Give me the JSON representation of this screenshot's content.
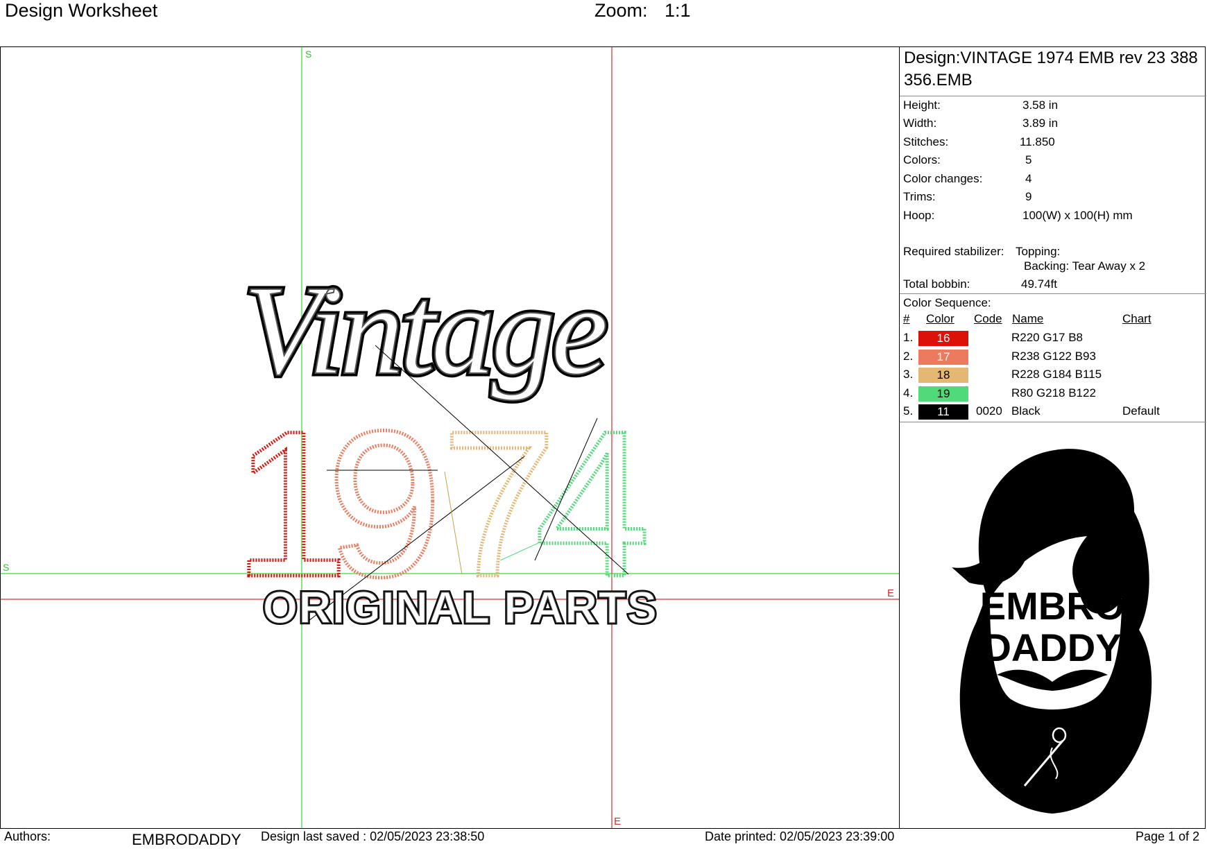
{
  "header": {
    "title": "Design Worksheet",
    "zoom_label": "Zoom:",
    "zoom_value": "1:1"
  },
  "canvas": {
    "guide_labels": {
      "s_top": "S",
      "s_left": "S",
      "e_right": "E",
      "e_bottom": "E"
    },
    "design_text": {
      "script": "Vintage",
      "year_digits": [
        "1",
        "9",
        "7",
        "4"
      ],
      "subtitle": "ORIGINAL PARTS"
    },
    "colors": {
      "green_guide": "#5de05d",
      "red_guide": "#e05555"
    }
  },
  "panel": {
    "design_name": "Design:VINTAGE 1974 EMB rev 23 388 356.EMB",
    "info": [
      {
        "label": "Height:",
        "value": "3.58 in"
      },
      {
        "label": "Width:",
        "value": "3.89 in"
      },
      {
        "label": "Stitches:",
        "value": "11.850"
      },
      {
        "label": "Colors:",
        "value": "5"
      },
      {
        "label": "Color changes:",
        "value": "4"
      },
      {
        "label": "Trims:",
        "value": "9"
      },
      {
        "label": "Hoop:",
        "value": "100(W) x 100(H) mm"
      }
    ],
    "stabilizer": {
      "label": "Required stabilizer:",
      "topping": "Topping:",
      "backing": "Backing: Tear Away x 2"
    },
    "bobbin": {
      "label": "Total bobbin:",
      "value": "49.74ft"
    },
    "sequence": {
      "title": "Color Sequence:",
      "headers": {
        "num": "#",
        "color": "Color",
        "code": "Code",
        "name": "Name",
        "chart": "Chart"
      },
      "rows": [
        {
          "num": "1.",
          "swatch": "16",
          "hex": "#dc1108",
          "code": "",
          "name": "R220 G17 B8",
          "chart": ""
        },
        {
          "num": "2.",
          "swatch": "17",
          "hex": "#ee7a5d",
          "code": "",
          "name": "R238 G122 B93",
          "chart": ""
        },
        {
          "num": "3.",
          "swatch": "18",
          "hex": "#e4b873",
          "code": "",
          "name": "R228 G184 B115",
          "chart": ""
        },
        {
          "num": "4.",
          "swatch": "19",
          "hex": "#50da7a",
          "code": "",
          "name": "R80 G218 B122",
          "chart": ""
        },
        {
          "num": "5.",
          "swatch": "11",
          "hex": "#000000",
          "code": "0020",
          "name": "Black",
          "chart": "Default"
        }
      ]
    },
    "logo": {
      "line1": "EMBRO",
      "line2": "DADDY"
    }
  },
  "footer": {
    "authors_label": "Authors:",
    "authors_value": "EMBRODADDY",
    "saved": "Design last saved : 02/05/2023 23:38:50",
    "printed": "Date printed: 02/05/2023 23:39:00",
    "page": "Page 1 of 2"
  }
}
